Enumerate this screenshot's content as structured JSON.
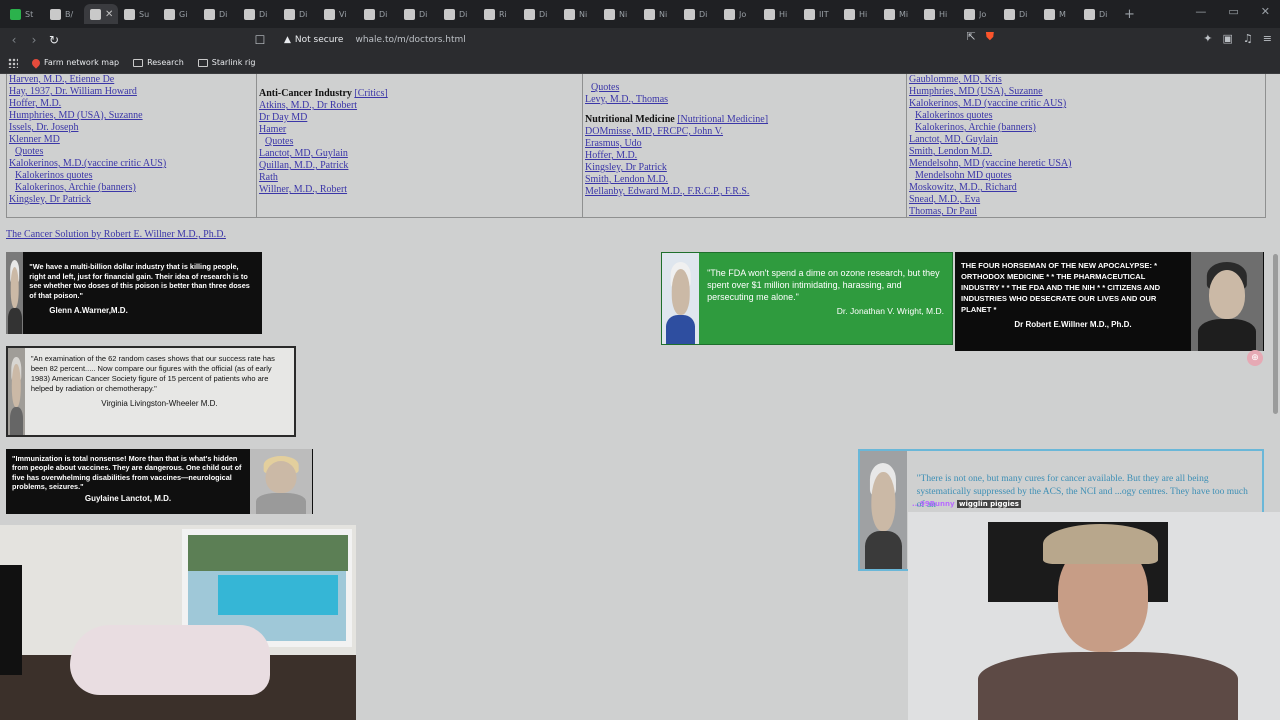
{
  "browser": {
    "tabs": [
      {
        "label": "St",
        "favicon": "green"
      },
      {
        "label": "B/",
        "favicon": "grey"
      },
      {
        "label": "",
        "favicon": "grey",
        "active": true
      },
      {
        "label": "Su",
        "favicon": "grey"
      },
      {
        "label": "Gi",
        "favicon": "grey"
      },
      {
        "label": "Di",
        "favicon": "grey"
      },
      {
        "label": "Di",
        "favicon": "grey"
      },
      {
        "label": "Di",
        "favicon": "grey"
      },
      {
        "label": "Vi",
        "favicon": "grey"
      },
      {
        "label": "Di",
        "favicon": "grey"
      },
      {
        "label": "Di",
        "favicon": "grey"
      },
      {
        "label": "Di",
        "favicon": "grey"
      },
      {
        "label": "Ri",
        "favicon": "grey"
      },
      {
        "label": "Di",
        "favicon": "grey"
      },
      {
        "label": "Ni",
        "favicon": "grey"
      },
      {
        "label": "Ni",
        "favicon": "grey"
      },
      {
        "label": "Ni",
        "favicon": "grey"
      },
      {
        "label": "Di",
        "favicon": "grey"
      },
      {
        "label": "Jo",
        "favicon": "grey"
      },
      {
        "label": "Hi",
        "favicon": "grey"
      },
      {
        "label": "IIT",
        "favicon": "grey"
      },
      {
        "label": "Hi",
        "favicon": "grey"
      },
      {
        "label": "Mi",
        "favicon": "grey"
      },
      {
        "label": "Hi",
        "favicon": "grey"
      },
      {
        "label": "Jo",
        "favicon": "grey"
      },
      {
        "label": "Di",
        "favicon": "grey"
      },
      {
        "label": "M",
        "favicon": "grey"
      },
      {
        "label": "Di",
        "favicon": "grey"
      }
    ],
    "tab_close": "✕",
    "new_tab": "+",
    "window_controls": [
      "—",
      "▭",
      "✕"
    ],
    "nav": {
      "back": "‹",
      "forward": "›",
      "reload": "↻"
    },
    "bookmark_icon": "☐",
    "security_label": "Not secure",
    "url": "whale.to/m/doctors.html",
    "bookmarks": [
      {
        "label": "Farm network map",
        "icon": "pin-icon"
      },
      {
        "label": "Research",
        "icon": "folder-icon"
      },
      {
        "label": "Starlink rig",
        "icon": "folder-icon"
      }
    ]
  },
  "doctors_table": {
    "col1": [
      {
        "text": "Harven, M.D., Etienne De",
        "indent": false
      },
      {
        "text": "Hay, 1937, Dr. William Howard",
        "indent": false
      },
      {
        "text": "Hoffer, M.D.",
        "indent": false
      },
      {
        "text": "Humphries, MD (USA), Suzanne",
        "indent": false
      },
      {
        "text": "Issels, Dr. Joseph",
        "indent": false
      },
      {
        "text": "Klenner MD",
        "indent": false
      },
      {
        "text": "Quotes",
        "indent": true
      },
      {
        "text": "Kalokerinos, M.D.(vaccine critic AUS)",
        "indent": false
      },
      {
        "text": "Kalokerinos quotes",
        "indent": true
      },
      {
        "text": "Kalokerinos, Archie (banners)",
        "indent": true
      },
      {
        "text": "Kingsley, Dr Patrick",
        "indent": false
      }
    ],
    "col2_header": "Anti-Cancer Industry",
    "col2_header_link": "[Critics]",
    "col2": [
      {
        "text": "Atkins, M.D., Dr Robert",
        "indent": false
      },
      {
        "text": "Dr Day MD",
        "indent": false
      },
      {
        "text": "Hamer",
        "indent": false
      },
      {
        "text": "Quotes",
        "indent": true
      },
      {
        "text": "Lanctot, MD, Guylain",
        "indent": false
      },
      {
        "text": "Quillan, M.D., Patrick",
        "indent": false
      },
      {
        "text": "Rath",
        "indent": false
      },
      {
        "text": "Willner, M.D., Robert",
        "indent": false
      }
    ],
    "col3_top": [
      {
        "text": "Quotes",
        "indent": true
      },
      {
        "text": "Levy, M.D., Thomas",
        "indent": false
      }
    ],
    "col3_header": "Nutritional Medicine",
    "col3_header_link": "[Nutritional Medicine]",
    "col3": [
      {
        "text": "DOMmisse, MD, FRCPC, John V.",
        "indent": false
      },
      {
        "text": "Erasmus, Udo",
        "indent": false
      },
      {
        "text": "Hoffer, M.D.",
        "indent": false
      },
      {
        "text": "Kingsley, Dr Patrick",
        "indent": false
      },
      {
        "text": "Smith, Lendon M.D.",
        "indent": false
      },
      {
        "text": "Mellanby, Edward M.D., F.R.C.P., F.R.S.",
        "indent": false
      }
    ],
    "col4": [
      {
        "text": "Gaublomme, MD, Kris",
        "indent": false
      },
      {
        "text": "Humphries, MD (USA), Suzanne",
        "indent": false
      },
      {
        "text": "Kalokerinos, M.D (vaccine critic AUS)",
        "indent": false
      },
      {
        "text": "Kalokerinos quotes",
        "indent": true
      },
      {
        "text": "Kalokerinos, Archie (banners)",
        "indent": true
      },
      {
        "text": "Lanctot, MD, Guylain",
        "indent": false
      },
      {
        "text": "Smith, Lendon M.D.",
        "indent": false
      },
      {
        "text": "Mendelsohn, MD (vaccine heretic USA)",
        "indent": false
      },
      {
        "text": "Mendelsohn MD quotes",
        "indent": true
      },
      {
        "text": "Moskowitz, M.D., Richard",
        "indent": false
      },
      {
        "text": "Snead, M.D., Eva",
        "indent": false
      },
      {
        "text": "Thomas, Dr Paul",
        "indent": false
      }
    ]
  },
  "cancer_solution_link": "The Cancer Solution by Robert E. Willner M.D., Ph.D.",
  "quotes": {
    "warner": {
      "text": "\"We have a multi-billion dollar industry that is killing people, right and left, just for financial gain. Their idea of research is to see whether two doses of this poison is better than three doses of that poison.\"",
      "author": "Glenn A.Warner,M.D."
    },
    "wheeler": {
      "text": "\"An examination of the 62 random cases shows that our success rate has been 82 percent..... Now compare our figures with the official (as of early 1983) American Cancer Society figure of 15 percent of patients who are helped by radiation or chemotherapy.\"",
      "author": "Virginia Livingston-Wheeler M.D."
    },
    "lanctot": {
      "text": "\"Immunization is total nonsense! More than that is what's hidden from people about vaccines. They are dangerous. One child out of five has overwhelming disabilities from vaccines—neurological problems, seizures.\"",
      "author": "Guylaine Lanctot, M.D."
    },
    "wright": {
      "text": "\"The FDA won't spend a dime on ozone research, but they spent over $1 million intimidating, harassing, and persecuting me alone.\"",
      "author": "Dr. Jonathan V. Wright, M.D."
    },
    "willner": {
      "text": "THE FOUR HORSEMAN OF THE NEW APOCALYPSE: * ORTHODOX MEDICINE * * THE PHARMACEUTICAL INDUSTRY * * THE FDA AND THE NIH * * CITIZENS AND INDUSTRIES WHO DESECRATE OUR LIVES AND OUR PLANET *",
      "author": "Dr Robert E.Willner M.D., Ph.D."
    },
    "cures": {
      "text": "\"There is not one, but many cures for cancer available. But they are all being systematically suppressed by the ACS, the NCI and ...ogy centres. They have too much of an"
    }
  },
  "stream_overlay": {
    "chat_user": "...99Bunny",
    "chat_text": "wigglin piggies"
  },
  "colors": {
    "link": "#3b36a8",
    "page_bg": "#cfd0d0",
    "wright_bg": "#2f9b3e",
    "cures_border": "#6ab7d8"
  }
}
